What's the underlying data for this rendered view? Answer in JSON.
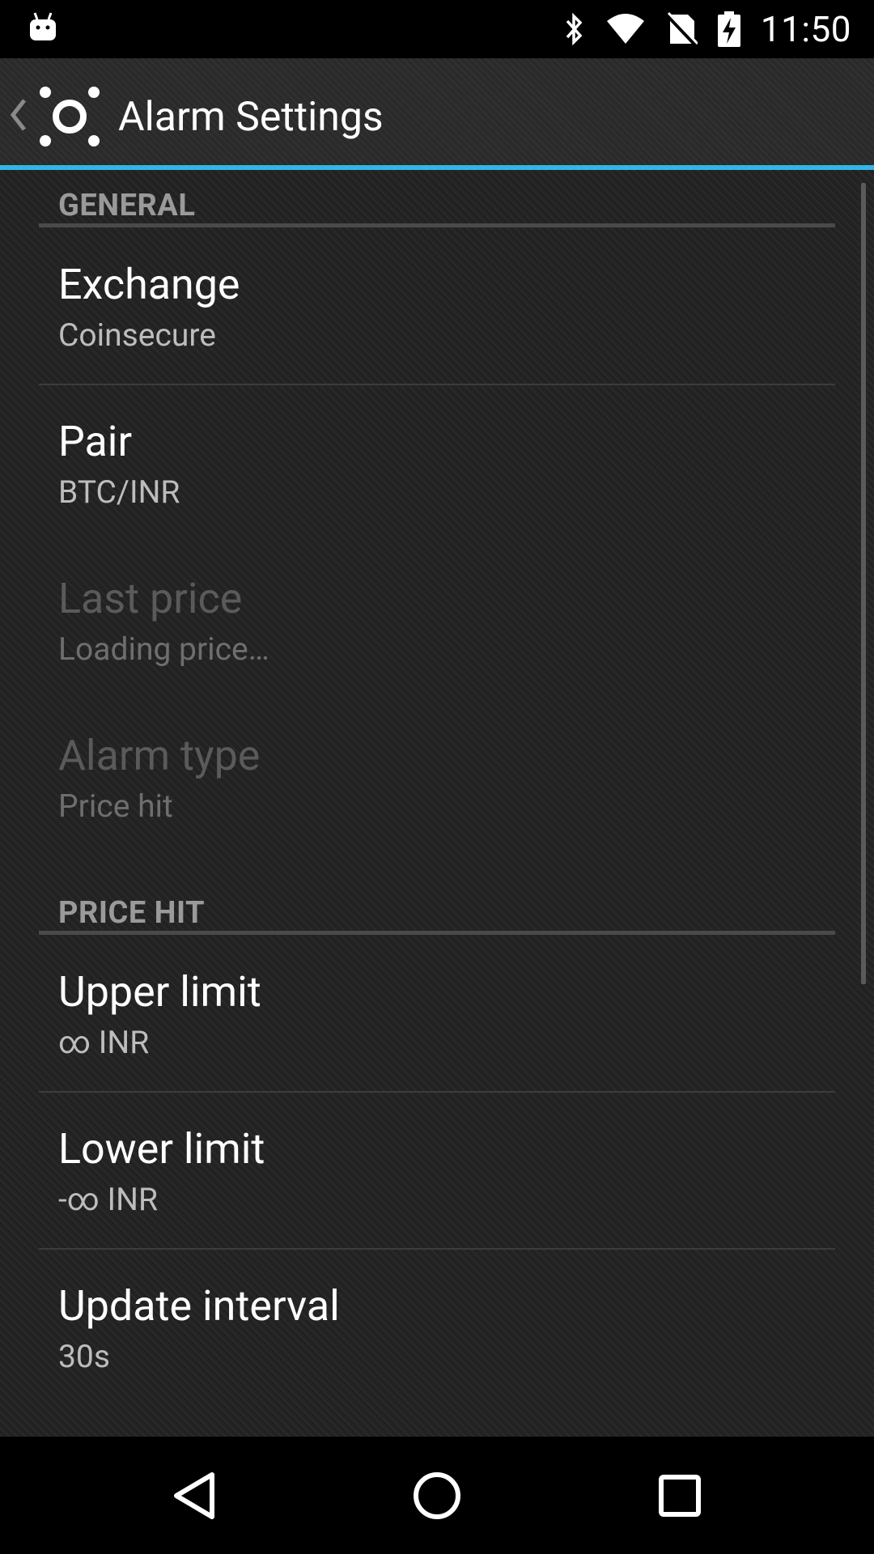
{
  "status_bar": {
    "time": "11:50",
    "icons": [
      "android-notification-icon",
      "bluetooth-icon",
      "wifi-icon",
      "no-sim-icon",
      "battery-charging-icon"
    ]
  },
  "action_bar": {
    "title": "Alarm Settings",
    "accent_color": "#33b5e5"
  },
  "sections": {
    "general": {
      "header": "GENERAL",
      "items": [
        {
          "title": "Exchange",
          "summary": "Coinsecure"
        },
        {
          "title": "Pair",
          "summary": "BTC/INR"
        },
        {
          "title": "Last price",
          "summary": "Loading price…"
        },
        {
          "title": "Alarm type",
          "summary": "Price hit"
        }
      ]
    },
    "price_hit": {
      "header": "PRICE HIT",
      "items": [
        {
          "title": "Upper limit",
          "summary": "∞ INR"
        },
        {
          "title": "Lower limit",
          "summary": "-∞ INR"
        },
        {
          "title": "Update interval",
          "summary": "30s"
        }
      ]
    }
  },
  "nav_bar": {
    "buttons": [
      "back-icon",
      "home-icon",
      "recents-icon"
    ]
  }
}
